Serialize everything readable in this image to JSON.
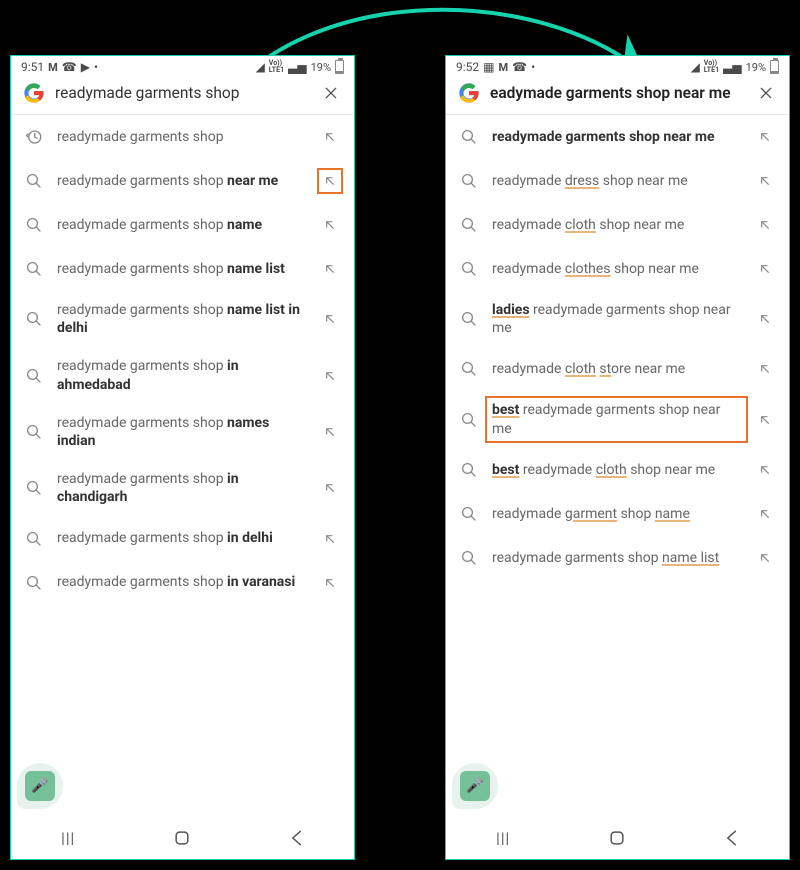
{
  "left": {
    "status": {
      "time": "9:51",
      "battery": "19%"
    },
    "query": "readymade garments shop",
    "suggestions": [
      {
        "icon": "history",
        "parts": [
          [
            "",
            "readymade garments shop"
          ]
        ]
      },
      {
        "icon": "search",
        "parts": [
          [
            "",
            "readymade garments shop "
          ],
          [
            "b",
            "near me"
          ]
        ],
        "highlightArrow": true
      },
      {
        "icon": "search",
        "parts": [
          [
            "",
            "readymade garments shop "
          ],
          [
            "b",
            "name"
          ]
        ]
      },
      {
        "icon": "search",
        "parts": [
          [
            "",
            "readymade garments shop "
          ],
          [
            "b",
            "name list"
          ]
        ]
      },
      {
        "icon": "search",
        "parts": [
          [
            "",
            "readymade garments shop "
          ],
          [
            "b",
            "name list in delhi"
          ]
        ]
      },
      {
        "icon": "search",
        "parts": [
          [
            "",
            "readymade garments shop "
          ],
          [
            "b",
            "in ahmedabad"
          ]
        ]
      },
      {
        "icon": "search",
        "parts": [
          [
            "",
            "readymade garments shop "
          ],
          [
            "b",
            "names indian"
          ]
        ]
      },
      {
        "icon": "search",
        "parts": [
          [
            "",
            "readymade garments shop "
          ],
          [
            "b",
            "in chandigarh"
          ]
        ]
      },
      {
        "icon": "search",
        "parts": [
          [
            "",
            "readymade garments shop "
          ],
          [
            "b",
            "in delhi"
          ]
        ]
      },
      {
        "icon": "search",
        "parts": [
          [
            "",
            "readymade garments shop "
          ],
          [
            "b",
            "in varanasi"
          ]
        ]
      }
    ]
  },
  "right": {
    "status": {
      "time": "9:52",
      "battery": "19%"
    },
    "query": "eadymade garments shop near me",
    "suggestions": [
      {
        "icon": "search",
        "parts": [
          [
            "b",
            "readymade garments shop near me"
          ]
        ]
      },
      {
        "icon": "search",
        "parts": [
          [
            "",
            "readymade "
          ],
          [
            "u",
            "dress"
          ],
          [
            "",
            " shop near me"
          ]
        ]
      },
      {
        "icon": "search",
        "parts": [
          [
            "",
            "readymade "
          ],
          [
            "u",
            "cloth"
          ],
          [
            "",
            " shop near me"
          ]
        ]
      },
      {
        "icon": "search",
        "parts": [
          [
            "",
            "readymade "
          ],
          [
            "u",
            "clothes"
          ],
          [
            "",
            " shop near me"
          ]
        ]
      },
      {
        "icon": "search",
        "parts": [
          [
            "ub",
            "ladies"
          ],
          [
            "",
            " readymade garments shop near me"
          ]
        ]
      },
      {
        "icon": "search",
        "parts": [
          [
            "",
            "readymade "
          ],
          [
            "u",
            "cloth"
          ],
          [
            "",
            " "
          ],
          [
            "u",
            "st"
          ],
          [
            "",
            "ore near me"
          ]
        ]
      },
      {
        "icon": "search",
        "parts": [
          [
            "ub",
            "best"
          ],
          [
            "",
            " readymade garments shop near me"
          ]
        ],
        "highlightRow": true
      },
      {
        "icon": "search",
        "parts": [
          [
            "ub",
            "best"
          ],
          [
            "",
            " readymade "
          ],
          [
            "u",
            "cloth"
          ],
          [
            "",
            " shop near me"
          ]
        ]
      },
      {
        "icon": "search",
        "parts": [
          [
            "",
            "readymade "
          ],
          [
            "u",
            "garment"
          ],
          [
            "",
            " shop "
          ],
          [
            "u",
            "name"
          ]
        ]
      },
      {
        "icon": "search",
        "parts": [
          [
            "",
            "readymade garments shop "
          ],
          [
            "u",
            "name list"
          ]
        ]
      }
    ]
  }
}
